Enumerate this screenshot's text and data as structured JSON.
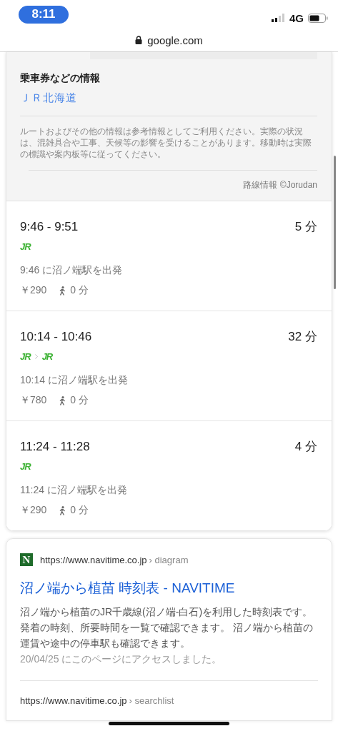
{
  "status_bar": {
    "time": "8:11",
    "network": "4G"
  },
  "address_bar": {
    "url": "google.com"
  },
  "ticket_info": {
    "title": "乗車券などの情報",
    "link": "ＪＲ北海道",
    "notice": "ルートおよびその他の情報は参考情報としてご利用ください。実際の状況は、混雑具合や工事、天候等の影響を受けることがあります。移動時は実際の標識や案内板等に従ってください。",
    "credit": "路線情報 ©Jorudan"
  },
  "routes": [
    {
      "time": "9:46 - 9:51",
      "duration": "5 分",
      "lines": [
        "JR"
      ],
      "departure": "9:46 に沼ノ端駅を出発",
      "fare": "￥290",
      "walk": "0 分"
    },
    {
      "time": "10:14 - 10:46",
      "duration": "32 分",
      "lines": [
        "JR",
        "JR"
      ],
      "departure": "10:14 に沼ノ端駅を出発",
      "fare": "￥780",
      "walk": "0 分"
    },
    {
      "time": "11:24 - 11:28",
      "duration": "4 分",
      "lines": [
        "JR"
      ],
      "departure": "11:24 に沼ノ端駅を出発",
      "fare": "￥290",
      "walk": "0 分"
    }
  ],
  "results": [
    {
      "favicon": "N",
      "url": "https://www.navitime.co.jp",
      "path": "› diagram",
      "title": "沼ノ端から植苗 時刻表 - NAVITIME",
      "snippet": "沼ノ端から植苗のJR千歳線(沼ノ端-白石)を利用した時刻表です。発着の時刻、所要時間を一覧で確認できます。 沼ノ端から植苗の運賃や途中の停車駅も確認できます。",
      "visited": "20/04/25 にこのページにアクセスしました。"
    },
    {
      "url": "https://www.navitime.co.jp",
      "path": "› searchlist"
    }
  ]
}
